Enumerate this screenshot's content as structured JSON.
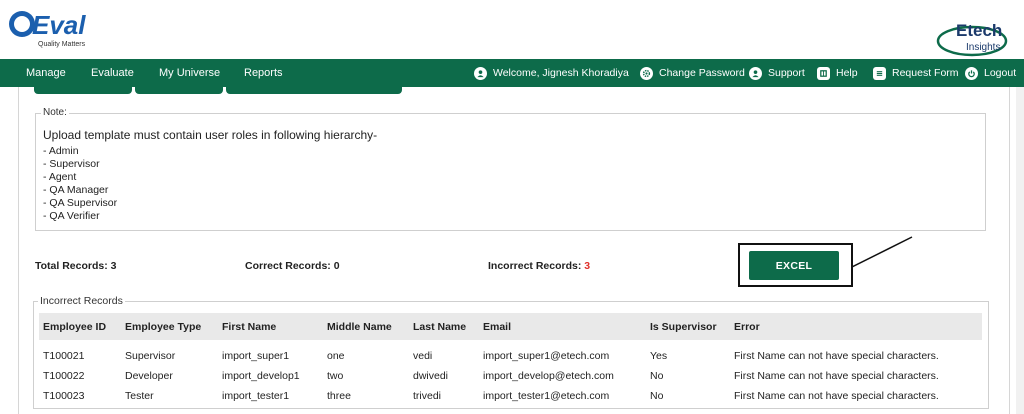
{
  "brand": {
    "left_logo_text": "QEval",
    "left_logo_tagline": "Quality Matters",
    "right_logo_line1": "Etech",
    "right_logo_line2": "Insights",
    "accent": "#0d6b4a"
  },
  "nav": {
    "items": [
      "Manage",
      "Evaluate",
      "My Universe",
      "Reports"
    ],
    "welcome": "Welcome, Jignesh Khoradiya",
    "change_password": "Change Password",
    "support": "Support",
    "help": "Help",
    "request_form": "Request Form",
    "logout": "Logout"
  },
  "note": {
    "legend": "Note:",
    "heading": "Upload template must contain user roles in following hierarchy-",
    "roles": [
      "- Admin",
      "- Supervisor",
      "- Agent",
      "- QA Manager",
      "- QA Supervisor",
      "- QA Verifier"
    ]
  },
  "records": {
    "total_label": "Total Records:",
    "total_value": "3",
    "correct_label": "Correct Records:",
    "correct_value": "0",
    "incorrect_label": "Incorrect Records:",
    "incorrect_value": "3",
    "incorrect_color": "#e0302b"
  },
  "excel_button": "EXCEL",
  "incorrect_table": {
    "legend": "Incorrect Records",
    "columns": [
      "Employee ID",
      "Employee Type",
      "First Name",
      "Middle Name",
      "Last Name",
      "Email",
      "Is Supervisor",
      "Error"
    ],
    "rows": [
      [
        "T100021",
        "Supervisor",
        "import_super1",
        "one",
        "vedi",
        "import_super1@etech.com",
        "Yes",
        "First Name can not have special characters."
      ],
      [
        "T100022",
        "Developer",
        "import_develop1",
        "two",
        "dwivedi",
        "import_develop@etech.com",
        "No",
        "First Name can not have special characters."
      ],
      [
        "T100023",
        "Tester",
        "import_tester1",
        "three",
        "trivedi",
        "import_tester1@etech.com",
        "No",
        "First Name can not have special characters."
      ]
    ]
  }
}
